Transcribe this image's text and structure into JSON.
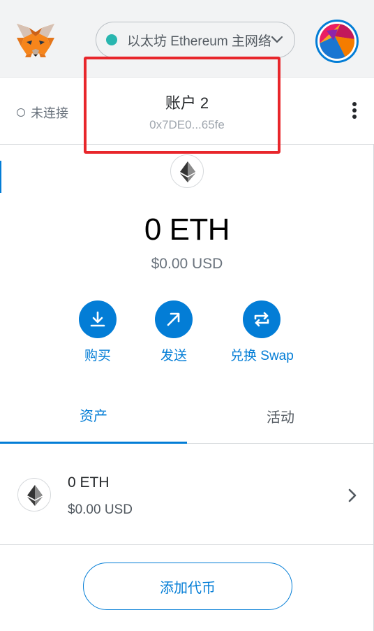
{
  "header": {
    "network": "以太坊 Ethereum 主网络",
    "network_color": "#29b6af"
  },
  "account": {
    "connection_status": "未连接",
    "name": "账户 2",
    "address": "0x7DE0...65fe"
  },
  "balance": {
    "primary": "0 ETH",
    "secondary": "$0.00 USD"
  },
  "actions": {
    "buy": "购买",
    "send": "发送",
    "swap": "兑换 Swap"
  },
  "tabs": {
    "assets": "资产",
    "activity": "活动"
  },
  "assets": [
    {
      "primary": "0 ETH",
      "secondary": "$0.00 USD"
    }
  ],
  "add_token_label": "添加代币",
  "colors": {
    "accent": "#037dd6",
    "highlight_box": "#e8262b"
  }
}
